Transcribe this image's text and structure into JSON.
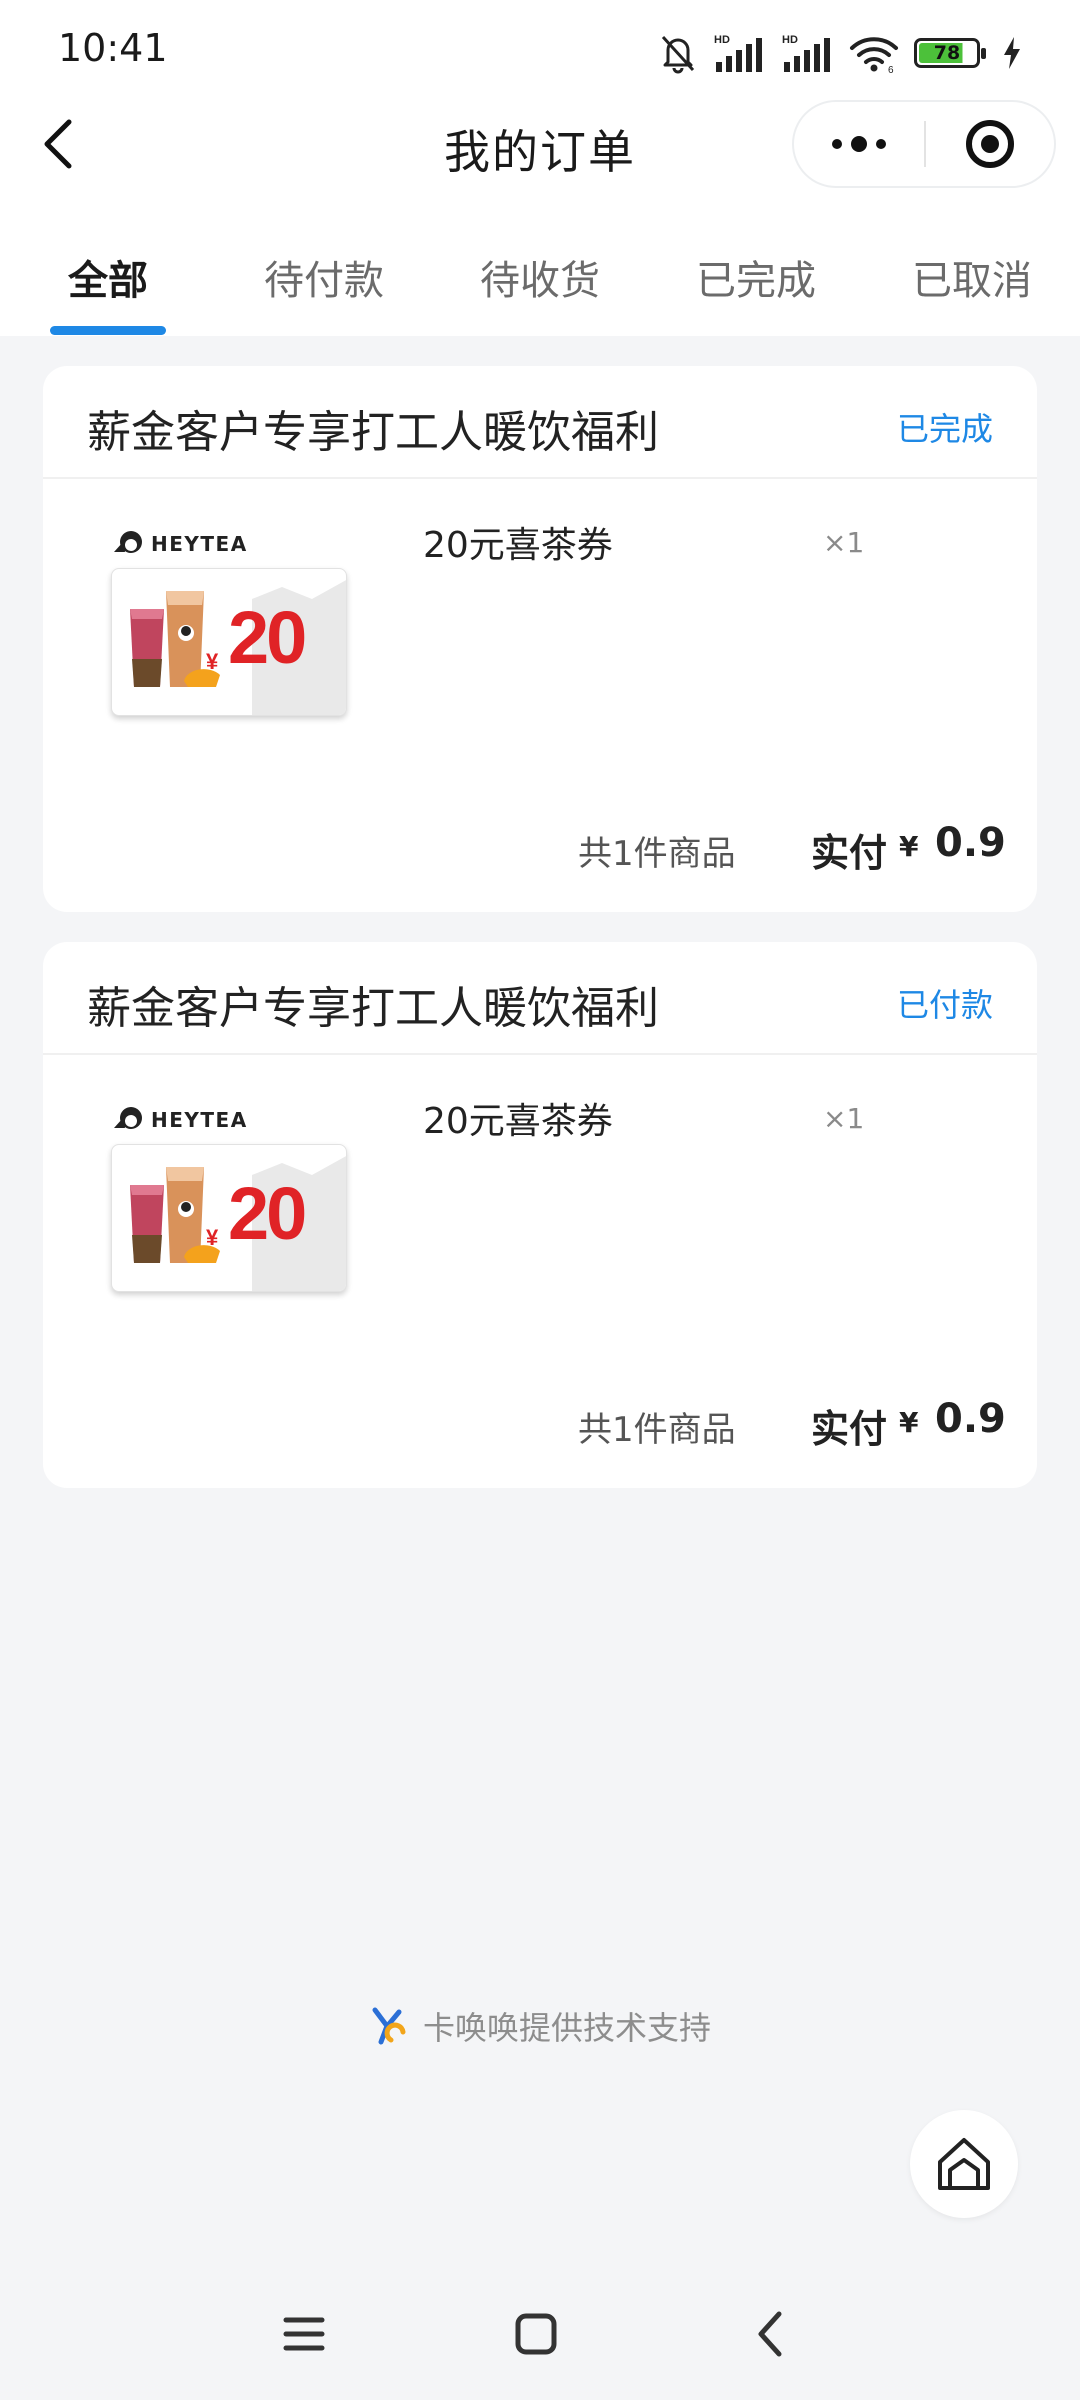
{
  "status_bar": {
    "time": "10:41",
    "battery_level": "78",
    "icons": [
      "mute-bell-icon",
      "hd-signal-icon",
      "hd-signal-icon",
      "wifi-icon",
      "battery-icon",
      "charging-icon"
    ]
  },
  "nav": {
    "title": "我的订单",
    "back_icon": "back-chevron-icon",
    "more_icon": "more-dots-icon",
    "close_icon": "target-close-icon"
  },
  "tabs": [
    {
      "label": "全部",
      "active": true
    },
    {
      "label": "待付款",
      "active": false
    },
    {
      "label": "待收货",
      "active": false
    },
    {
      "label": "已完成",
      "active": false
    },
    {
      "label": "已取消",
      "active": false
    }
  ],
  "orders": [
    {
      "title": "薪金客户专享打工人暖饮福利",
      "status": "已完成",
      "brand": "HEYTEA",
      "coupon_currency": "¥",
      "coupon_amount": "20",
      "product_name": "20元喜茶券",
      "quantity": "×1",
      "item_count": "共1件商品",
      "paid_label": "实付",
      "paid_currency": "¥",
      "paid_amount": "0.9"
    },
    {
      "title": "薪金客户专享打工人暖饮福利",
      "status": "已付款",
      "brand": "HEYTEA",
      "coupon_currency": "¥",
      "coupon_amount": "20",
      "product_name": "20元喜茶券",
      "quantity": "×1",
      "item_count": "共1件商品",
      "paid_label": "实付",
      "paid_currency": "¥",
      "paid_amount": "0.9"
    }
  ],
  "footer": {
    "support_text": "卡唤唤提供技术支持",
    "home_icon": "home-icon"
  },
  "system_nav": [
    "menu-icon",
    "home-square-icon",
    "back-icon"
  ],
  "colors": {
    "accent": "#1e88e5",
    "coupon_red": "#e02326",
    "background": "#f4f5f7",
    "battery_green": "#4cc13a"
  }
}
